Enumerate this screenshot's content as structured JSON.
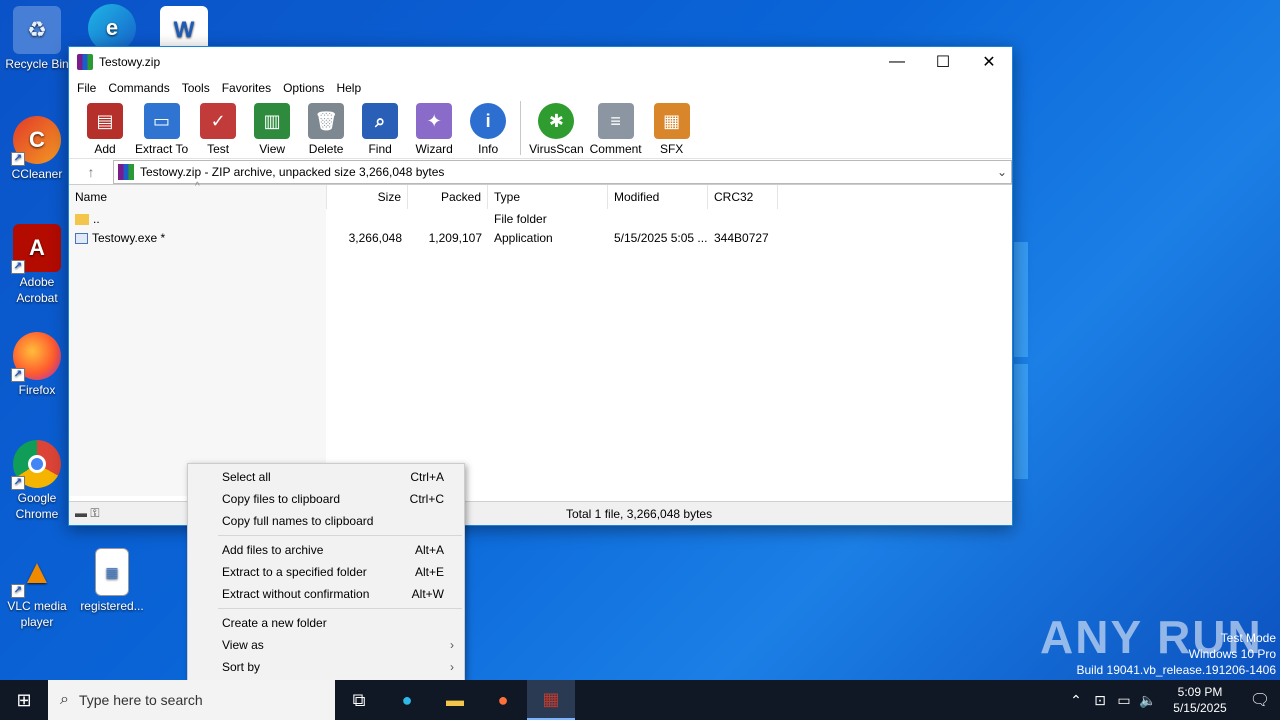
{
  "desktop": {
    "icons": [
      {
        "label": "Recycle Bin",
        "icon": "recycle-bin-icon"
      },
      {
        "label": "CCleaner",
        "icon": "ccleaner-icon"
      },
      {
        "label": "Adobe Acrobat",
        "icon": "adobe-acrobat-icon"
      },
      {
        "label": "Firefox",
        "icon": "firefox-icon"
      },
      {
        "label": "Google Chrome",
        "icon": "chrome-icon"
      },
      {
        "label": "VLC media player",
        "icon": "vlc-icon"
      },
      {
        "label": "registered...",
        "icon": "image-file-icon"
      }
    ]
  },
  "window": {
    "title": "Testowy.zip",
    "menu": [
      "File",
      "Commands",
      "Tools",
      "Favorites",
      "Options",
      "Help"
    ],
    "toolbar": [
      {
        "label": "Add",
        "icon": "add-icon",
        "color": "#b5302a"
      },
      {
        "label": "Extract To",
        "icon": "extract-folder-icon",
        "color": "#2f74d0"
      },
      {
        "label": "Test",
        "icon": "test-clipboard-icon",
        "color": "#c23b3b"
      },
      {
        "label": "View",
        "icon": "view-book-icon",
        "color": "#2e8b3e"
      },
      {
        "label": "Delete",
        "icon": "trash-icon",
        "color": "#7d8891"
      },
      {
        "label": "Find",
        "icon": "find-magnifier-icon",
        "color": "#2a5fb8"
      },
      {
        "label": "Wizard",
        "icon": "wizard-wand-icon",
        "color": "#8a6bc9"
      },
      {
        "label": "Info",
        "icon": "info-icon",
        "color": "#2d6fd0"
      },
      {
        "label": "VirusScan",
        "icon": "virusscan-icon",
        "color": "#2e9c2e"
      },
      {
        "label": "Comment",
        "icon": "comment-icon",
        "color": "#8c96a3"
      },
      {
        "label": "SFX",
        "icon": "sfx-icon",
        "color": "#d9862a"
      }
    ],
    "address": "Testowy.zip - ZIP archive, unpacked size 3,266,048 bytes",
    "columns": [
      "Name",
      "Size",
      "Packed",
      "Type",
      "Modified",
      "CRC32"
    ],
    "rows": [
      {
        "name": "..",
        "size": "",
        "packed": "",
        "type": "File folder",
        "modified": "",
        "crc": ""
      },
      {
        "name": "Testowy.exe *",
        "size": "3,266,048",
        "packed": "1,209,107",
        "type": "Application",
        "modified": "5/15/2025 5:05 ...",
        "crc": "344B0727"
      }
    ],
    "status": "Total 1 file, 3,266,048 bytes"
  },
  "context_menu": {
    "groups": [
      [
        {
          "label": "Select all",
          "shortcut": "Ctrl+A"
        },
        {
          "label": "Copy files to clipboard",
          "shortcut": "Ctrl+C"
        },
        {
          "label": "Copy full names to clipboard",
          "shortcut": ""
        }
      ],
      [
        {
          "label": "Add files to archive",
          "shortcut": "Alt+A"
        },
        {
          "label": "Extract to a specified folder",
          "shortcut": "Alt+E"
        },
        {
          "label": "Extract without confirmation",
          "shortcut": "Alt+W"
        }
      ],
      [
        {
          "label": "Create a new folder",
          "shortcut": ""
        },
        {
          "label": "View as",
          "shortcut": ""
        },
        {
          "label": "Sort by",
          "shortcut": ""
        }
      ]
    ]
  },
  "watermark": {
    "logo": "ANY RUN",
    "lines": [
      "Test Mode",
      "Windows 10 Pro",
      "Build 19041.vb_release.191206-1406"
    ]
  },
  "taskbar": {
    "search_placeholder": "Type here to search",
    "time": "5:09 PM",
    "date": "5/15/2025"
  }
}
